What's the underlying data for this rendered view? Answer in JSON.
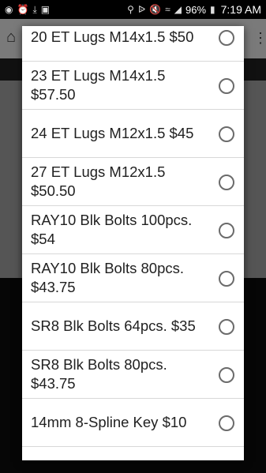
{
  "status_bar": {
    "icons_left": [
      "messenger-icon",
      "alarm-icon",
      "download-icon",
      "gallery-icon"
    ],
    "icons_right": [
      "location-icon",
      "bluetooth-icon",
      "mute-icon",
      "wifi-icon",
      "signal-icon"
    ],
    "battery": "96%",
    "time": "7:19 AM"
  },
  "dialog": {
    "options": [
      {
        "label": "20 ET Lugs M14x1.5 $50",
        "selected": false
      },
      {
        "label": "23 ET Lugs M14x1.5 $57.50",
        "selected": false
      },
      {
        "label": "24 ET Lugs M12x1.5 $45",
        "selected": false
      },
      {
        "label": "27 ET Lugs M12x1.5 $50.50",
        "selected": false
      },
      {
        "label": "RAY10 Blk Bolts 100pcs. $54",
        "selected": false
      },
      {
        "label": "RAY10 Blk Bolts 80pcs. $43.75",
        "selected": false
      },
      {
        "label": "SR8 Blk Bolts 64pcs. $35",
        "selected": false
      },
      {
        "label": "SR8 Blk Bolts 80pcs. $43.75",
        "selected": false
      },
      {
        "label": "14mm 8-Spline Key $10",
        "selected": false
      }
    ]
  }
}
